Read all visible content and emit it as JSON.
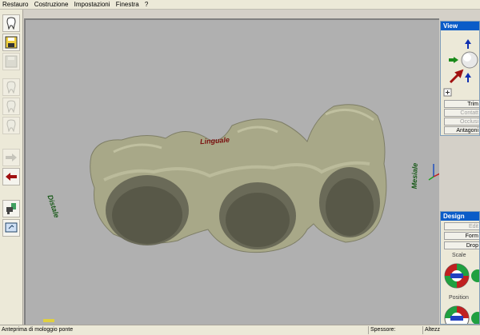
{
  "menu": {
    "items": [
      "Restauro",
      "Costruzione",
      "Impostazioni",
      "Finestra",
      "?"
    ]
  },
  "viewport": {
    "labels": {
      "lingual": "Linguale",
      "distal": "Distale",
      "mesial": "Mesiale"
    }
  },
  "view_panel": {
    "title": "View",
    "buttons": {
      "trim": "Trim",
      "contact": "Contatt",
      "occlusion": "Occlusi",
      "antagonist": "Antagoni"
    }
  },
  "design_panel": {
    "title": "Design",
    "buttons": {
      "edit": "Edit",
      "form": "Form",
      "drop": "Drop"
    },
    "sections": {
      "scale": "Scale",
      "position": "Position"
    }
  },
  "status": {
    "message": "Anteprima di mologgio ponte",
    "thickness_label": "Spessore:",
    "height_label": "Altezz"
  },
  "colors": {
    "viewport_bg": "#b0b0b0",
    "tooth": "#a8a888",
    "panel_title": "#0a5cc8",
    "lingual_label": "#7a1010",
    "side_label": "#1a5a1a"
  }
}
